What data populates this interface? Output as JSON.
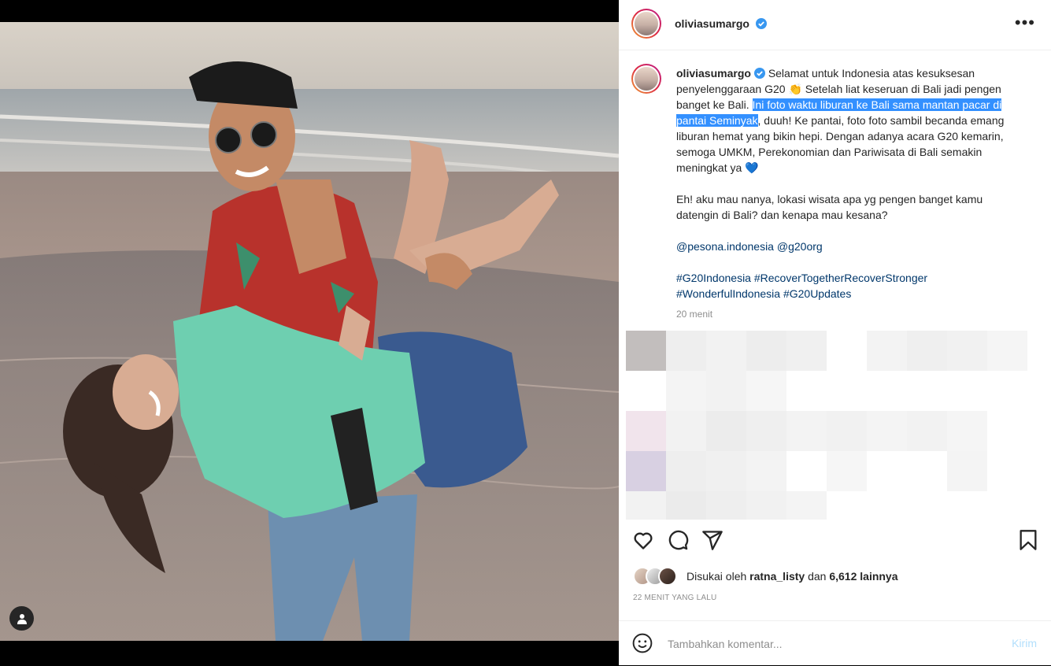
{
  "post": {
    "username": "oliviasumargo",
    "verified": true,
    "caption_part1": "Selamat untuk Indonesia atas kesuksesan penyelenggaraan G20 👏 Setelah liat keseruan di Bali jadi pengen banget ke Bali. ",
    "caption_highlight": "Ini foto waktu liburan ke Bali sama mantan pacar di pantai Seminyak",
    "caption_part2": ", duuh! Ke pantai, foto foto sambil becanda emang liburan hemat yang bikin hepi. Dengan adanya acara G20 kemarin, semoga UMKM, Perekonomian dan Pariwisata di Bali semakin meningkat ya 💙",
    "question": "Eh! aku mau nanya, lokasi wisata apa yg pengen banget kamu datengin di Bali? dan kenapa mau kesana?",
    "mention1": "@pesona.indonesia",
    "mention2": "@g20org",
    "hashtags_line1": "#G20Indonesia #RecoverTogetherRecoverStronger",
    "hashtags_line2": "#WonderfulIndonesia #G20Updates",
    "caption_time": "20 menit"
  },
  "likes": {
    "prefix": "Disukai oleh",
    "user": "ratna_listy",
    "middle": "dan",
    "count": "6,612 lainnya"
  },
  "posted_time": "22 MENIT YANG LALU",
  "comment": {
    "placeholder": "Tambahkan komentar...",
    "post_label": "Kirim"
  },
  "icons": {
    "more": "more-options-icon",
    "like": "heart-icon",
    "comment": "comment-icon",
    "share": "share-icon",
    "save": "bookmark-icon",
    "emoji": "emoji-icon",
    "tagged": "user-tag-icon",
    "verified": "verified-badge-icon"
  },
  "colors": {
    "verified": "#3897f0",
    "highlight": "#3390ff",
    "link": "#00376b",
    "post_disabled": "#b2dffc"
  }
}
